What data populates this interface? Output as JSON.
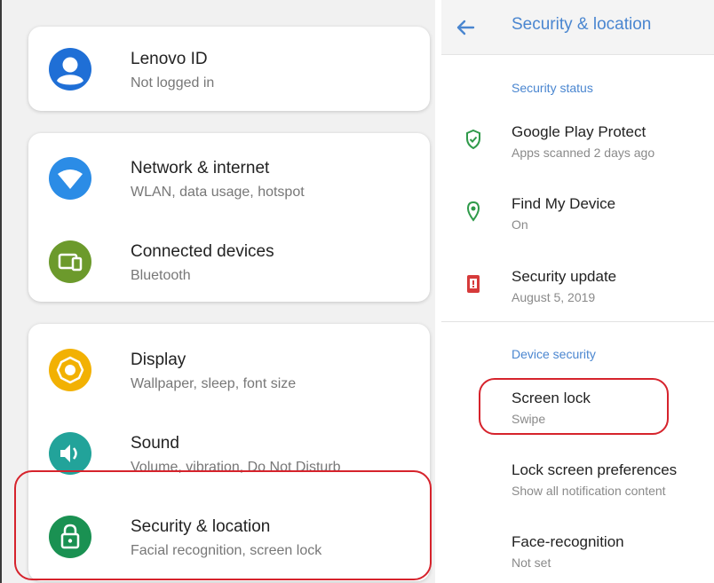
{
  "left": {
    "items": [
      {
        "title": "Lenovo ID",
        "subtitle": "Not logged in",
        "icon": "account-icon",
        "color": "#1f6fd6"
      },
      {
        "title": "Network & internet",
        "subtitle": "WLAN, data usage, hotspot",
        "icon": "wifi-icon",
        "color": "#2b8ce6"
      },
      {
        "title": "Connected devices",
        "subtitle": "Bluetooth",
        "icon": "devices-icon",
        "color": "#6c9a2c"
      },
      {
        "title": "Display",
        "subtitle": "Wallpaper, sleep, font size",
        "icon": "brightness-icon",
        "color": "#f2b103"
      },
      {
        "title": "Sound",
        "subtitle": "Volume, vibration, Do Not Disturb",
        "icon": "volume-icon",
        "color": "#22a39a"
      },
      {
        "title": "Security & location",
        "subtitle": "Facial recognition, screen lock",
        "icon": "lock-icon",
        "color": "#1a9152"
      }
    ]
  },
  "right": {
    "title": "Security & location",
    "accent": "#4a86d0",
    "security_status_header": "Security status",
    "status_items": [
      {
        "title": "Google Play Protect",
        "subtitle": "Apps scanned 2 days ago",
        "icon": "shield-check-icon",
        "color": "#2f9a4a"
      },
      {
        "title": "Find My Device",
        "subtitle": "On",
        "icon": "location-pin-icon",
        "color": "#2f9a4a"
      },
      {
        "title": "Security update",
        "subtitle": "August 5, 2019",
        "icon": "phone-update-icon",
        "color": "#d63a3a"
      }
    ],
    "device_security_header": "Device security",
    "device_items": [
      {
        "title": "Screen lock",
        "subtitle": "Swipe"
      },
      {
        "title": "Lock screen preferences",
        "subtitle": "Show all notification content"
      },
      {
        "title": "Face-recognition",
        "subtitle": "Not set"
      }
    ]
  },
  "highlight_color": "#d6232c"
}
